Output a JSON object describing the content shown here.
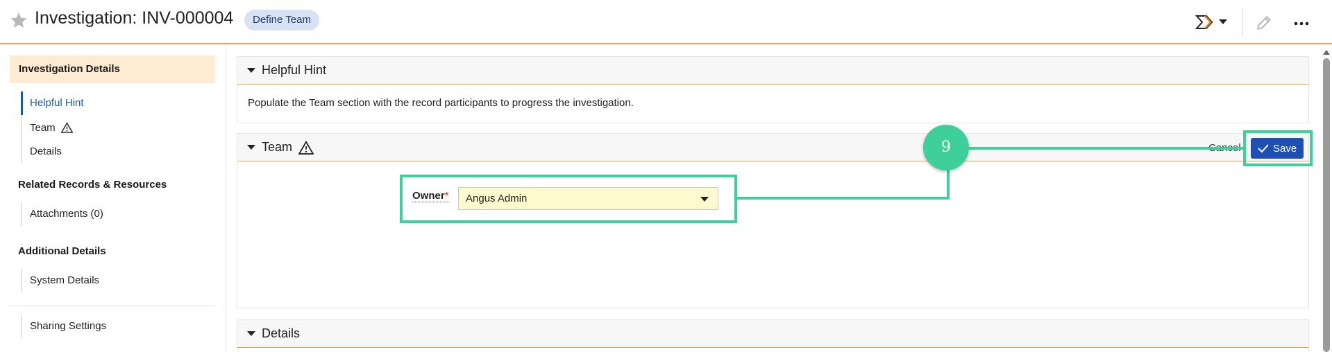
{
  "header": {
    "title": "Investigation: INV-000004",
    "stage_badge": "Define Team",
    "icons": [
      "star-icon",
      "stage-flow-icon",
      "chevron-down-icon",
      "pencil-icon",
      "more-icon"
    ]
  },
  "sidebar": {
    "active_section": "Investigation Details",
    "group1": [
      {
        "label": "Helpful Hint",
        "active": true
      },
      {
        "label": "Team",
        "warning": true
      },
      {
        "label": "Details"
      }
    ],
    "heading2": "Related Records & Resources",
    "group2": [
      {
        "label": "Attachments (0)"
      }
    ],
    "heading3": "Additional Details",
    "group3": [
      {
        "label": "System Details"
      }
    ],
    "group4": [
      {
        "label": "Sharing Settings"
      }
    ]
  },
  "hint_panel": {
    "title": "Helpful Hint",
    "text": "Populate the Team section with the record participants to progress the investigation."
  },
  "team_panel": {
    "title": "Team",
    "cancel_label": "Cancel",
    "save_label": "Save",
    "owner_label": "Owner",
    "owner_required": "*",
    "owner_value": "Angus Admin"
  },
  "details_panel": {
    "title": "Details"
  },
  "annotation": {
    "step": "9",
    "color": "#3ecf9a"
  },
  "colors": {
    "accent": "#f0a04b",
    "primary": "#1d4fb5",
    "link": "#1a56c4"
  }
}
